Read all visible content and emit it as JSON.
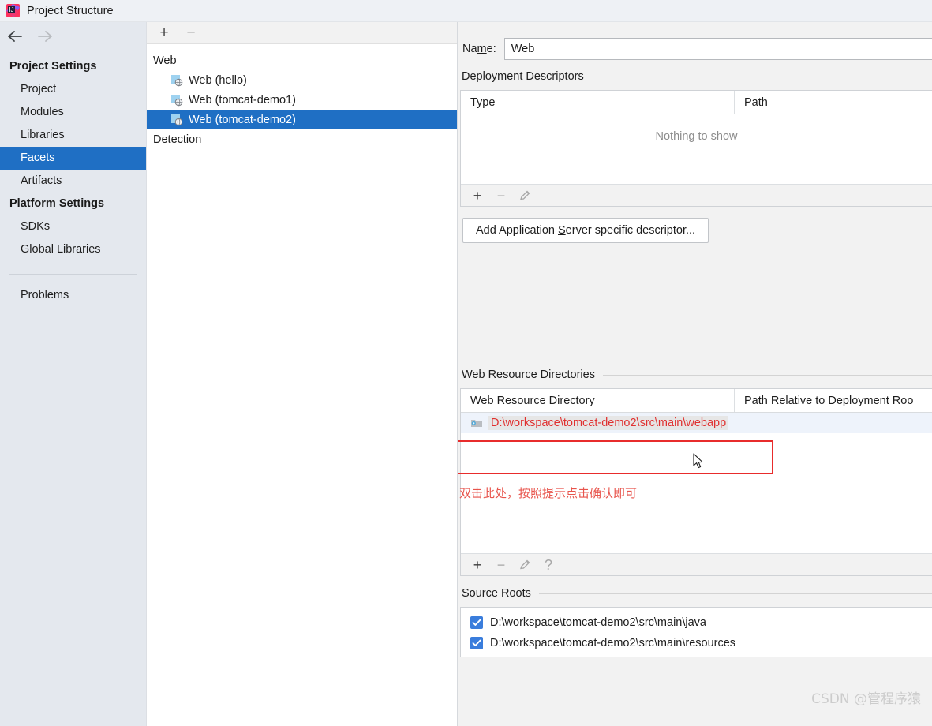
{
  "window": {
    "title": "Project Structure",
    "app_icon": "intellij-idea-icon"
  },
  "nav": {
    "back_icon": "arrow-left-icon",
    "forward_icon": "arrow-right-icon"
  },
  "sidebar": {
    "groups": [
      {
        "header": "Project Settings",
        "items": [
          {
            "label": "Project",
            "selected": false
          },
          {
            "label": "Modules",
            "selected": false
          },
          {
            "label": "Libraries",
            "selected": false
          },
          {
            "label": "Facets",
            "selected": true
          },
          {
            "label": "Artifacts",
            "selected": false
          }
        ]
      },
      {
        "header": "Platform Settings",
        "items": [
          {
            "label": "SDKs",
            "selected": false
          },
          {
            "label": "Global Libraries",
            "selected": false
          }
        ]
      }
    ],
    "problems_label": "Problems"
  },
  "tree": {
    "toolbar": {
      "add_label": "+",
      "remove_label": "−"
    },
    "rows": [
      {
        "label": "Web",
        "level": 0,
        "icon": null,
        "selected": false
      },
      {
        "label": "Web (hello)",
        "level": 1,
        "icon": "web-facet-icon",
        "selected": false
      },
      {
        "label": "Web (tomcat-demo1)",
        "level": 1,
        "icon": "web-facet-icon",
        "selected": false
      },
      {
        "label": "Web (tomcat-demo2)",
        "level": 1,
        "icon": "web-facet-icon",
        "selected": true
      },
      {
        "label": "Detection",
        "level": 0,
        "icon": null,
        "selected": false
      }
    ]
  },
  "detail": {
    "name_label_pre": "Na",
    "name_label_mnemonic": "m",
    "name_label_post": "e:",
    "name_value": "Web",
    "deployment_descriptors": {
      "title": "Deployment Descriptors",
      "columns": [
        "Type",
        "Path"
      ],
      "empty_text": "Nothing to show",
      "toolbar": [
        "add-icon",
        "remove-icon",
        "edit-pencil-icon"
      ],
      "add_button_pre": "Add Application ",
      "add_button_mnemonic": "S",
      "add_button_post": "erver specific descriptor..."
    },
    "web_resource_directories": {
      "title": "Web Resource Directories",
      "columns": [
        "Web Resource Directory",
        "Path Relative to Deployment Roo"
      ],
      "rows": [
        {
          "icon": "folder-icon",
          "path": "D:\\workspace\\tomcat-demo2\\src\\main\\webapp",
          "relative_path": ""
        }
      ],
      "toolbar": [
        "add-icon",
        "remove-icon",
        "edit-pencil-icon",
        "help-icon"
      ]
    },
    "source_roots": {
      "title": "Source Roots",
      "rows": [
        {
          "checked": true,
          "path": "D:\\workspace\\tomcat-demo2\\src\\main\\java"
        },
        {
          "checked": true,
          "path": "D:\\workspace\\tomcat-demo2\\src\\main\\resources"
        }
      ]
    }
  },
  "annotation": {
    "text": "双击此处，按照提示点击确认即可",
    "box_color": "#e82c2c",
    "text_color": "#e8544c"
  },
  "watermark": {
    "text": "CSDN @管程序猿"
  },
  "colors": {
    "selection_blue": "#1f6fc4",
    "sidebar_bg": "#e4e8ee",
    "panel_bg": "#f2f2f2",
    "checkbox_blue": "#3a7ddc",
    "path_red": "#e03030"
  }
}
